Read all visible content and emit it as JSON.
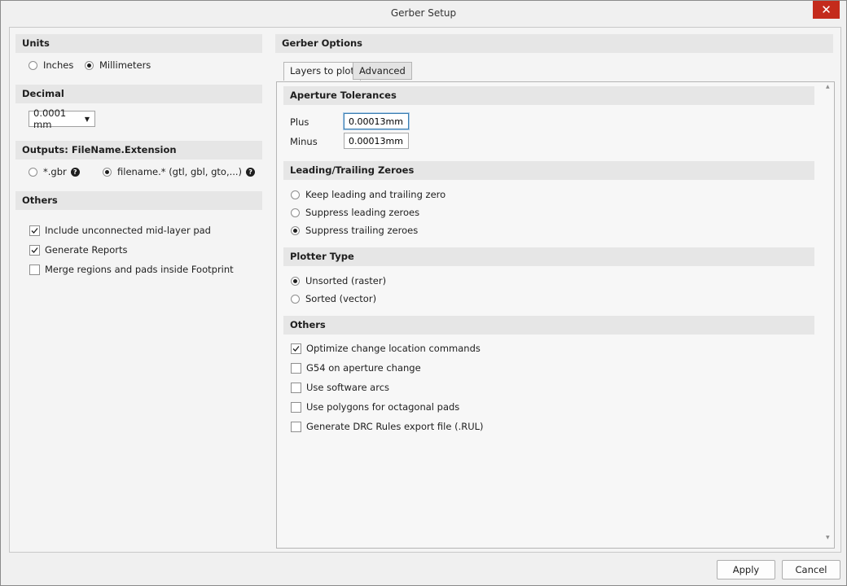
{
  "window": {
    "title": "Gerber Setup",
    "close_glyph": "✕"
  },
  "left": {
    "units": {
      "heading": "Units",
      "options": [
        "Inches",
        "Millimeters"
      ],
      "selected": "Millimeters"
    },
    "decimal": {
      "heading": "Decimal",
      "value": "0.0001 mm"
    },
    "outputs": {
      "heading": "Outputs: FileName.Extension",
      "options": [
        "*.gbr",
        "filename.* (gtl, gbl, gto,...)"
      ],
      "selected": "filename.* (gtl, gbl, gto,...)"
    },
    "others": {
      "heading": "Others",
      "items": [
        {
          "label": "Include unconnected mid-layer pad",
          "checked": true
        },
        {
          "label": "Generate Reports",
          "checked": true
        },
        {
          "label": "Merge regions and pads inside Footprint",
          "checked": false
        }
      ]
    }
  },
  "right": {
    "heading": "Gerber Options",
    "tabs": [
      "Layers to plot",
      "Advanced"
    ],
    "active_tab": "Layers to plot",
    "aperture": {
      "heading": "Aperture Tolerances",
      "plus_label": "Plus",
      "plus_value": "0.00013mm",
      "minus_label": "Minus",
      "minus_value": "0.00013mm"
    },
    "zeroes": {
      "heading": "Leading/Trailing Zeroes",
      "options": [
        "Keep leading and trailing zero",
        "Suppress leading zeroes",
        "Suppress trailing zeroes"
      ],
      "selected": "Suppress trailing zeroes"
    },
    "plotter": {
      "heading": "Plotter Type",
      "options": [
        "Unsorted (raster)",
        "Sorted (vector)"
      ],
      "selected": "Unsorted (raster)"
    },
    "others": {
      "heading": "Others",
      "items": [
        {
          "label": "Optimize change location commands",
          "checked": true
        },
        {
          "label": "G54 on aperture change",
          "checked": false
        },
        {
          "label": "Use software arcs",
          "checked": false
        },
        {
          "label": "Use polygons for octagonal pads",
          "checked": false
        },
        {
          "label": "Generate DRC Rules export file (.RUL)",
          "checked": false
        }
      ]
    }
  },
  "footer": {
    "apply_label": "Apply",
    "cancel_label": "Cancel"
  },
  "icons": {
    "help": "?",
    "dropdown": "▼",
    "scroll_up": "▲",
    "scroll_down": "▼"
  }
}
